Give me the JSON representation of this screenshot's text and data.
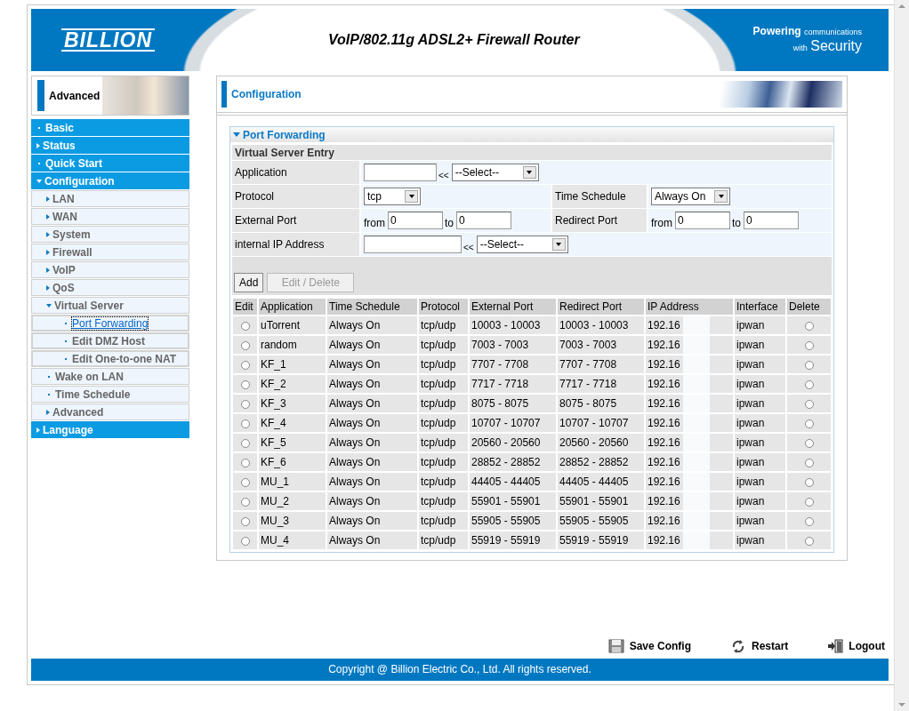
{
  "header": {
    "logo": "BILLION",
    "title": "VoIP/802.11g ADSL2+ Firewall Router",
    "tagline": [
      [
        {
          "text": "Powering",
          "emphasis": true
        },
        {
          "text": "communications",
          "emphasis": false
        }
      ],
      [
        {
          "text": "with",
          "emphasis": false
        },
        {
          "text": "Security",
          "emphasis": true
        }
      ]
    ]
  },
  "sidebar": {
    "banner": "Advanced",
    "items": [
      {
        "label": "Basic",
        "kind": "page",
        "selected": false
      },
      {
        "label": "Status",
        "kind": "folder",
        "expanded": false,
        "selected": false
      },
      {
        "label": "Quick Start",
        "kind": "page",
        "selected": false
      },
      {
        "label": "Configuration",
        "kind": "folder",
        "expanded": true,
        "selected": false,
        "children": [
          {
            "label": "LAN",
            "kind": "folder",
            "expanded": false,
            "selected": false
          },
          {
            "label": "WAN",
            "kind": "folder",
            "expanded": false,
            "selected": false
          },
          {
            "label": "System",
            "kind": "folder",
            "expanded": false,
            "selected": false
          },
          {
            "label": "Firewall",
            "kind": "folder",
            "expanded": false,
            "selected": false
          },
          {
            "label": "VoIP",
            "kind": "folder",
            "expanded": false,
            "selected": false
          },
          {
            "label": "QoS",
            "kind": "folder",
            "expanded": false,
            "selected": false
          },
          {
            "label": "Virtual Server",
            "kind": "folder",
            "expanded": true,
            "selected": false,
            "children": [
              {
                "label": "Port Forwarding",
                "kind": "page",
                "selected": true
              },
              {
                "label": "Edit DMZ Host",
                "kind": "page",
                "selected": false
              },
              {
                "label": "Edit One-to-one NAT",
                "kind": "page",
                "selected": false
              }
            ]
          },
          {
            "label": "Wake on LAN",
            "kind": "page",
            "selected": false
          },
          {
            "label": "Time Schedule",
            "kind": "page",
            "selected": false
          },
          {
            "label": "Advanced",
            "kind": "folder",
            "expanded": false,
            "selected": false
          }
        ]
      },
      {
        "label": "Language",
        "kind": "folder",
        "expanded": false,
        "selected": false
      }
    ]
  },
  "panel": {
    "title": "Configuration",
    "section": {
      "title": "Port Forwarding",
      "expanded": true
    },
    "form": {
      "heading": "Virtual Server Entry",
      "application": {
        "label": "Application",
        "arrows": "<<",
        "select": "--Select--"
      },
      "protocol": {
        "label": "Protocol",
        "select": "tcp"
      },
      "time_schedule": {
        "label": "Time Schedule",
        "select": "Always On"
      },
      "external_port": {
        "label": "External Port",
        "from_label": "from",
        "from": "0",
        "to_label": "to",
        "to": "0"
      },
      "redirect_port": {
        "label": "Redirect Port",
        "from_label": "from",
        "from": "0",
        "to_label": "to",
        "to": "0"
      },
      "internal_ip": {
        "label": "internal IP Address",
        "arrows": "<<",
        "select": "--Select--"
      },
      "buttons": [
        {
          "label": "Add",
          "disabled": false
        },
        {
          "label": "Edit / Delete",
          "disabled": true
        }
      ]
    },
    "table": {
      "columns": [
        "Edit",
        "Application",
        "Time Schedule",
        "Protocol",
        "External Port",
        "Redirect Port",
        "IP Address",
        "Interface",
        "Delete"
      ],
      "rows": [
        {
          "edit_checked": false,
          "application": "uTorrent",
          "schedule": "Always On",
          "protocol": "tcp/udp",
          "external_port": "10003 - 10003",
          "redirect_port": "10003 - 10003",
          "ip": "192.16",
          "interface": "ipwan",
          "delete_checked": false
        },
        {
          "edit_checked": false,
          "application": "random",
          "schedule": "Always On",
          "protocol": "tcp/udp",
          "external_port": "7003 - 7003",
          "redirect_port": "7003 - 7003",
          "ip": "192.16",
          "interface": "ipwan",
          "delete_checked": false
        },
        {
          "edit_checked": false,
          "application": "KF_1",
          "schedule": "Always On",
          "protocol": "tcp/udp",
          "external_port": "7707 - 7708",
          "redirect_port": "7707 - 7708",
          "ip": "192.16",
          "interface": "ipwan",
          "delete_checked": false
        },
        {
          "edit_checked": false,
          "application": "KF_2",
          "schedule": "Always On",
          "protocol": "tcp/udp",
          "external_port": "7717 - 7718",
          "redirect_port": "7717 - 7718",
          "ip": "192.16",
          "interface": "ipwan",
          "delete_checked": false
        },
        {
          "edit_checked": false,
          "application": "KF_3",
          "schedule": "Always On",
          "protocol": "tcp/udp",
          "external_port": "8075 - 8075",
          "redirect_port": "8075 - 8075",
          "ip": "192.16",
          "interface": "ipwan",
          "delete_checked": false
        },
        {
          "edit_checked": false,
          "application": "KF_4",
          "schedule": "Always On",
          "protocol": "tcp/udp",
          "external_port": "10707 - 10707",
          "redirect_port": "10707 - 10707",
          "ip": "192.16",
          "interface": "ipwan",
          "delete_checked": false
        },
        {
          "edit_checked": false,
          "application": "KF_5",
          "schedule": "Always On",
          "protocol": "tcp/udp",
          "external_port": "20560 - 20560",
          "redirect_port": "20560 - 20560",
          "ip": "192.16",
          "interface": "ipwan",
          "delete_checked": false
        },
        {
          "edit_checked": false,
          "application": "KF_6",
          "schedule": "Always On",
          "protocol": "tcp/udp",
          "external_port": "28852 - 28852",
          "redirect_port": "28852 - 28852",
          "ip": "192.16",
          "interface": "ipwan",
          "delete_checked": false
        },
        {
          "edit_checked": false,
          "application": "MU_1",
          "schedule": "Always On",
          "protocol": "tcp/udp",
          "external_port": "44405 - 44405",
          "redirect_port": "44405 - 44405",
          "ip": "192.16",
          "interface": "ipwan",
          "delete_checked": false
        },
        {
          "edit_checked": false,
          "application": "MU_2",
          "schedule": "Always On",
          "protocol": "tcp/udp",
          "external_port": "55901 - 55901",
          "redirect_port": "55901 - 55901",
          "ip": "192.16",
          "interface": "ipwan",
          "delete_checked": false
        },
        {
          "edit_checked": false,
          "application": "MU_3",
          "schedule": "Always On",
          "protocol": "tcp/udp",
          "external_port": "55905 - 55905",
          "redirect_port": "55905 - 55905",
          "ip": "192.16",
          "interface": "ipwan",
          "delete_checked": false
        },
        {
          "edit_checked": false,
          "application": "MU_4",
          "schedule": "Always On",
          "protocol": "tcp/udp",
          "external_port": "55919 - 55919",
          "redirect_port": "55919 - 55919",
          "ip": "192.16",
          "interface": "ipwan",
          "delete_checked": false
        }
      ]
    }
  },
  "footer": {
    "save_config": "Save Config",
    "restart": "Restart",
    "logout": "Logout",
    "copyright": "Copyright @ Billion Electric Co., Ltd. All rights reserved."
  }
}
